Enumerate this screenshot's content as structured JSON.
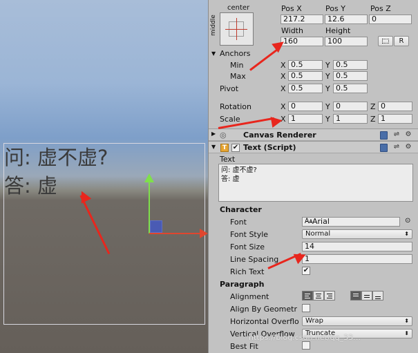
{
  "scene": {
    "text_lines": [
      "问: 虚不虚?",
      "答: 虚"
    ]
  },
  "rect_transform": {
    "anchor_preset_top": "center",
    "anchor_preset_side": "middle",
    "pos_x_label": "Pos X",
    "pos_y_label": "Pos Y",
    "pos_z_label": "Pos Z",
    "pos_x": "217.2",
    "pos_y": "12.6",
    "pos_z": "0",
    "width_label": "Width",
    "height_label": "Height",
    "width": "160",
    "height": "100",
    "raw_button": "R",
    "anchors_label": "Anchors",
    "min_label": "Min",
    "max_label": "Max",
    "pivot_label": "Pivot",
    "min_x": "0.5",
    "min_y": "0.5",
    "max_x": "0.5",
    "max_y": "0.5",
    "pivot_x": "0.5",
    "pivot_y": "0.5",
    "rotation_label": "Rotation",
    "scale_label": "Scale",
    "rot_x": "0",
    "rot_y": "0",
    "rot_z": "0",
    "scale_x": "1",
    "scale_y": "1",
    "scale_z": "1",
    "axis_x": "X",
    "axis_y": "Y",
    "axis_z": "Z"
  },
  "canvas_renderer": {
    "title": "Canvas Renderer"
  },
  "text_script": {
    "title": "Text (Script)",
    "text_label": "Text",
    "text_lines": [
      "问: 虚不虚?",
      "答: 虚"
    ],
    "character_label": "Character",
    "font_label": "Font",
    "font_value": "Arial",
    "font_style_label": "Font Style",
    "font_style_value": "Normal",
    "font_size_label": "Font Size",
    "font_size_value": "14",
    "line_spacing_label": "Line Spacing",
    "line_spacing_value": "1",
    "rich_text_label": "Rich Text",
    "rich_text_checked": "✔",
    "paragraph_label": "Paragraph",
    "alignment_label": "Alignment",
    "align_by_geometry_label": "Align By Geometr",
    "horizontal_overflow_label": "Horizontal Overflo",
    "horizontal_overflow_value": "Wrap",
    "vertical_overflow_label": "Vertical Overflow",
    "vertical_overflow_value": "Truncate",
    "best_fit_label": "Best Fit"
  },
  "watermark": "https://blog.csdn.net/qq_33…",
  "colors": {
    "annotation_red": "#e8261d",
    "gizmo_green": "#7fe04a",
    "gizmo_red": "#e0462e",
    "gizmo_blue": "#3c56d8"
  }
}
